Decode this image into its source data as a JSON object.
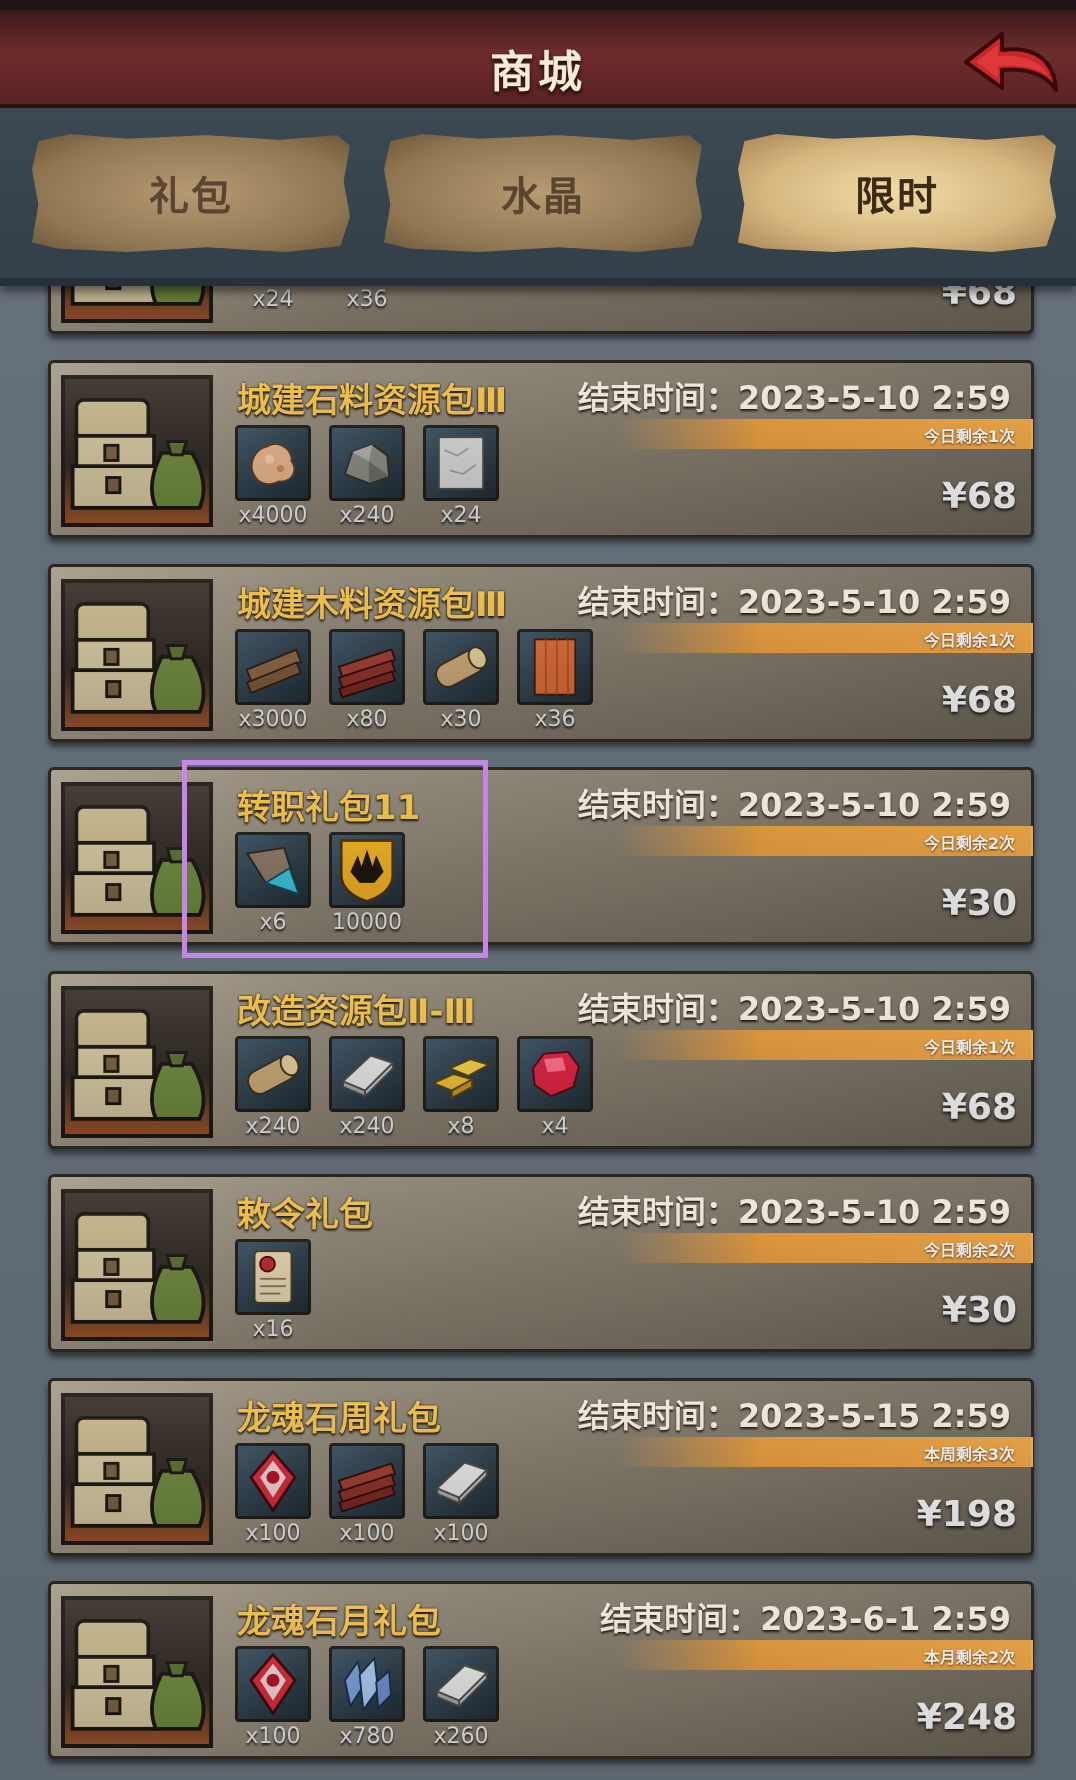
{
  "header": {
    "title": "商城"
  },
  "tabs": [
    {
      "label": "礼包",
      "active": false
    },
    {
      "label": "水晶",
      "active": false
    },
    {
      "label": "限时",
      "active": true
    }
  ],
  "partial_top": {
    "quantities": [
      "x24",
      "x36"
    ],
    "price": "¥68"
  },
  "packages": [
    {
      "name": "城建石料资源包Ⅲ",
      "end_time": "结束时间：2023-5-10 2:59",
      "limit": "今日剩余1次",
      "price": "¥68",
      "items": [
        {
          "icon": "ore-icon",
          "qty": "x4000"
        },
        {
          "icon": "stone-icon",
          "qty": "x240"
        },
        {
          "icon": "marble-block-icon",
          "qty": "x24"
        }
      ]
    },
    {
      "name": "城建木料资源包Ⅲ",
      "end_time": "结束时间：2023-5-10 2:59",
      "limit": "今日剩余1次",
      "price": "¥68",
      "items": [
        {
          "icon": "wood-planks-icon",
          "qty": "x3000"
        },
        {
          "icon": "red-lumber-icon",
          "qty": "x80"
        },
        {
          "icon": "log-icon",
          "qty": "x30"
        },
        {
          "icon": "wood-board-icon",
          "qty": "x36"
        }
      ]
    },
    {
      "name": "转职礼包11",
      "end_time": "结束时间：2023-5-10 2:59",
      "limit": "今日剩余2次",
      "price": "¥30",
      "items": [
        {
          "icon": "crystal-shard-icon",
          "qty": "x6"
        },
        {
          "icon": "gold-shield-icon",
          "qty": "10000"
        }
      ]
    },
    {
      "name": "改造资源包Ⅱ-Ⅲ",
      "end_time": "结束时间：2023-5-10 2:59",
      "limit": "今日剩余1次",
      "price": "¥68",
      "items": [
        {
          "icon": "log-icon",
          "qty": "x240"
        },
        {
          "icon": "iron-ingot-icon",
          "qty": "x240"
        },
        {
          "icon": "gold-bars-icon",
          "qty": "x8"
        },
        {
          "icon": "ruby-icon",
          "qty": "x4"
        }
      ]
    },
    {
      "name": "敕令礼包",
      "end_time": "结束时间：2023-5-10 2:59",
      "limit": "今日剩余2次",
      "price": "¥30",
      "items": [
        {
          "icon": "scroll-icon",
          "qty": "x16"
        }
      ]
    },
    {
      "name": "龙魂石周礼包",
      "end_time": "结束时间：2023-5-15 2:59",
      "limit": "本周剩余3次",
      "price": "¥198",
      "items": [
        {
          "icon": "dragon-soul-stone-icon",
          "qty": "x100"
        },
        {
          "icon": "red-lumber-icon",
          "qty": "x100"
        },
        {
          "icon": "iron-ingot-icon",
          "qty": "x100"
        }
      ]
    },
    {
      "name": "龙魂石月礼包",
      "end_time": "结束时间：2023-6-1 2:59",
      "limit": "本月剩余2次",
      "price": "¥248",
      "items": [
        {
          "icon": "dragon-soul-stone-icon",
          "qty": "x100"
        },
        {
          "icon": "blue-crystal-icon",
          "qty": "x780"
        },
        {
          "icon": "iron-ingot-icon",
          "qty": "x260"
        }
      ]
    }
  ]
}
